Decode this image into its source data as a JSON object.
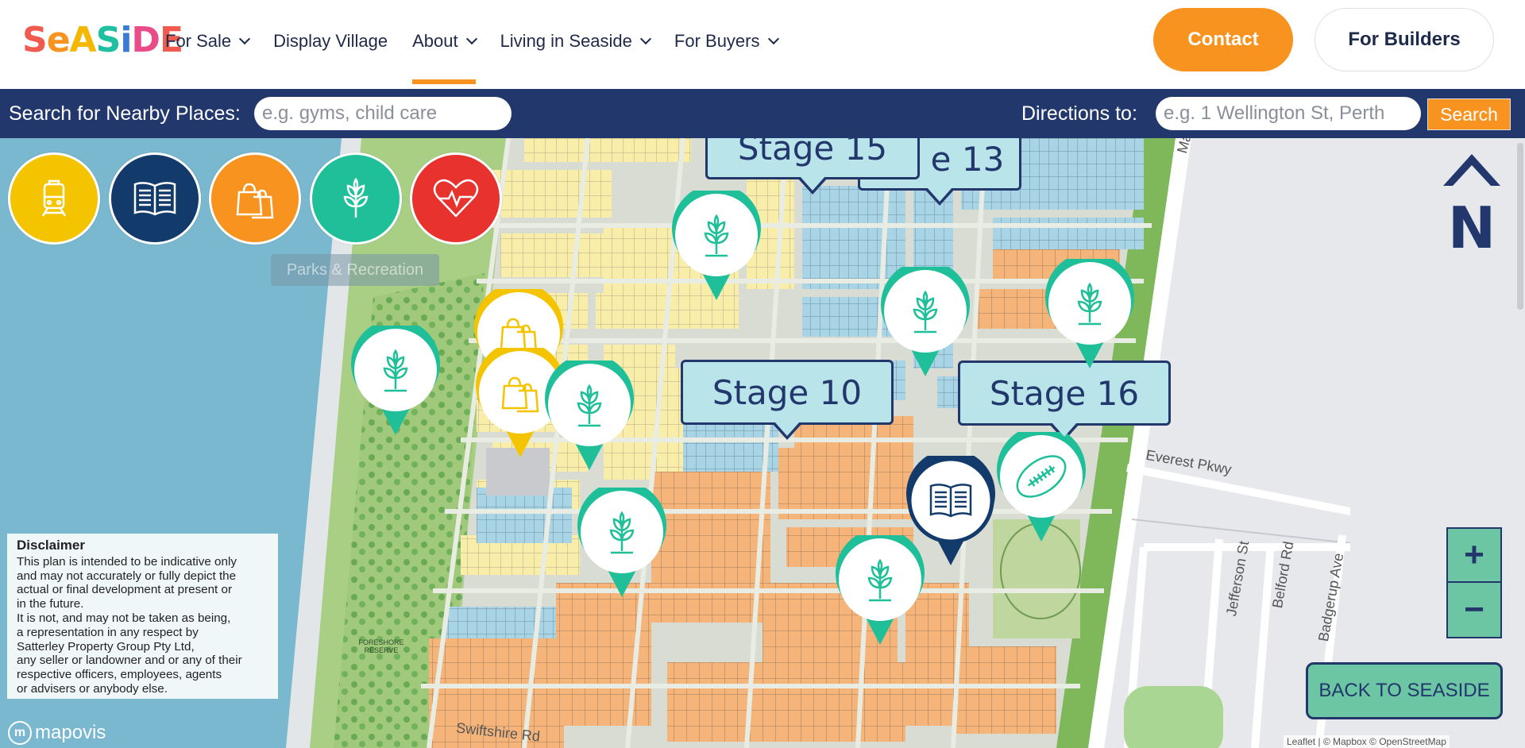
{
  "header": {
    "logo_letters": [
      "S",
      "e",
      "A",
      "S",
      "i",
      "D",
      "E"
    ],
    "nav": [
      {
        "label": "For Sale",
        "dropdown": true
      },
      {
        "label": "Display Village",
        "dropdown": false
      },
      {
        "label": "About",
        "dropdown": true,
        "active": true
      },
      {
        "label": "Living in Seaside",
        "dropdown": true
      },
      {
        "label": "For Buyers",
        "dropdown": true
      }
    ],
    "contact_label": "Contact",
    "builders_label": "For Builders"
  },
  "searchbar": {
    "nearby_label": "Search for Nearby Places:",
    "nearby_placeholder": "e.g. gyms, child care",
    "directions_label": "Directions to:",
    "directions_placeholder": "e.g. 1 Wellington St, Perth",
    "search_label": "Search"
  },
  "map": {
    "categories": [
      {
        "name": "transport",
        "icon": "train-icon",
        "color": "#f5c400"
      },
      {
        "name": "education",
        "icon": "book-icon",
        "color": "#123a6b"
      },
      {
        "name": "shopping",
        "icon": "shopping-bag-icon",
        "color": "#f7931e"
      },
      {
        "name": "parks",
        "icon": "sprout-icon",
        "color": "#1fbf9a"
      },
      {
        "name": "health",
        "icon": "heart-pulse-icon",
        "color": "#e8322e"
      }
    ],
    "tooltip": "Parks & Recreation",
    "stages": [
      "Stage 15",
      "e 13",
      "Stage 10",
      "Stage 16"
    ],
    "disclaimer": {
      "title": "Disclaimer",
      "lines": [
        "This plan is intended to be indicative only",
        "and may not accurately or fully depict the",
        "actual or final development at present or",
        "in the future.",
        "It is not, and may not be taken as being,",
        "a representation in any respect by",
        "Satterley Property Group Pty Ltd,",
        "any seller or landowner and or any of their",
        "respective officers, employees, agents",
        "or advisers or anybody else."
      ]
    },
    "brand": "mapovis",
    "roads": {
      "mandurah": "Mandurah Rd",
      "everest": "Everest Pkwy",
      "jefferson": "Jefferson St",
      "belford": "Belford Rd",
      "badgerup": "Badgerup Ave",
      "swiftshire": "Swiftshire Rd"
    },
    "zoom_in": "+",
    "zoom_out": "−",
    "back_label": "BACK TO SEASIDE",
    "attribution": "Leaflet | © Mapbox © OpenStreetMap",
    "compass_letter": "N",
    "reserve_label": "FORESHORE RESERVE"
  }
}
